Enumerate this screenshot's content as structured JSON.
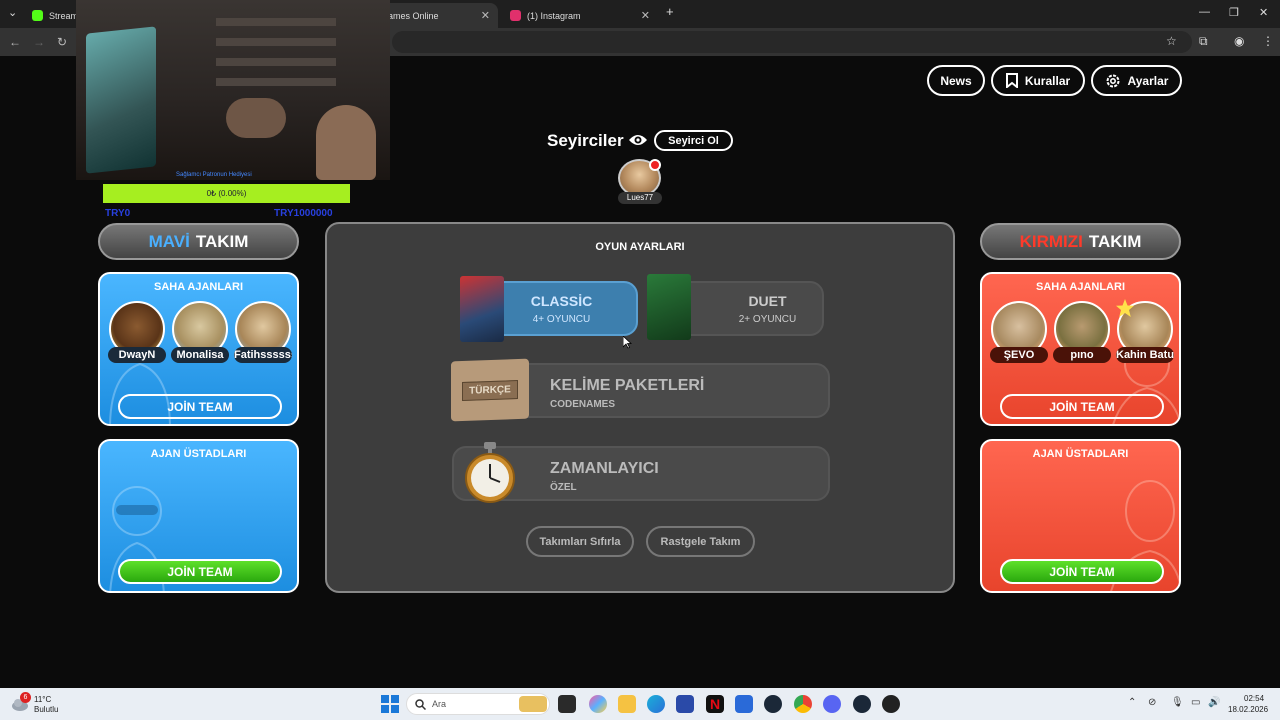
{
  "browser": {
    "tabs": [
      {
        "label": "Stream",
        "fav_color": "#53fc18"
      },
      {
        "label": "ames Online",
        "fav_color": "#ffffff"
      },
      {
        "label": "(1) Instagram",
        "fav_color": "#e1306c"
      }
    ],
    "new_tab": "+",
    "close": "✕"
  },
  "stream_overlay": {
    "caption": "Sağlamcı Patronun Hediyesi",
    "progress_text": "0₺ (0.00%)",
    "progress_fraction": 0.0,
    "left_label": "TRY0",
    "right_label": "TRY1000000"
  },
  "top_nav": {
    "news": "News",
    "rules": "Kurallar",
    "settings": "Ayarlar"
  },
  "spectators": {
    "title": "Seyirciler",
    "spectate_button": "Seyirci Ol",
    "users": [
      {
        "name": "Lues77"
      }
    ]
  },
  "blue_team": {
    "header_accent": "MAVİ",
    "header_rest": "TAKIM",
    "agents_title": "SAHA AJANLARI",
    "agents": [
      {
        "name": "DwayN"
      },
      {
        "name": "Monalisa"
      },
      {
        "name": "Fatihssssss"
      }
    ],
    "agents_join": "JOİN TEAM",
    "masters_title": "AJAN ÜSTADLARI",
    "masters_join": "JOİN TEAM"
  },
  "red_team": {
    "header_accent": "KIRMIZI",
    "header_rest": "TAKIM",
    "agents_title": "SAHA AJANLARI",
    "agents": [
      {
        "name": "ŞEVO"
      },
      {
        "name": "pıno"
      },
      {
        "name": "Kahin Batu"
      }
    ],
    "agents_join": "JOİN TEAM",
    "masters_title": "AJAN ÜSTADLARI",
    "masters_join": "JOİN TEAM"
  },
  "game_settings": {
    "title": "OYUN AYARLARI",
    "modes": [
      {
        "title": "CLASSİC",
        "subtitle": "4+ OYUNCU",
        "selected": true
      },
      {
        "title": "DUET",
        "subtitle": "2+ OYUNCU",
        "selected": false
      }
    ],
    "box_label": "CODENAMES",
    "word_packs": {
      "title": "KELİME PAKETLERİ",
      "subtitle": "CODENAMES",
      "sign": "TÜRKÇE"
    },
    "timer": {
      "title": "ZAMANLAYICI",
      "subtitle": "ÖZEL"
    },
    "reset_teams": "Takımları Sıfırla",
    "random_team": "Rastgele Takım"
  },
  "taskbar": {
    "weather_temp": "11°C",
    "weather_desc": "Bulutlu",
    "weather_badge": "6",
    "search_placeholder": "Ara",
    "time": "02:54",
    "date": "18.02.2026"
  },
  "colors": {
    "blue_accent": "#4ab0ff",
    "red_accent": "#ff3a2a",
    "join_green": "#3cc418",
    "classic_selected": "#3d7fae"
  }
}
